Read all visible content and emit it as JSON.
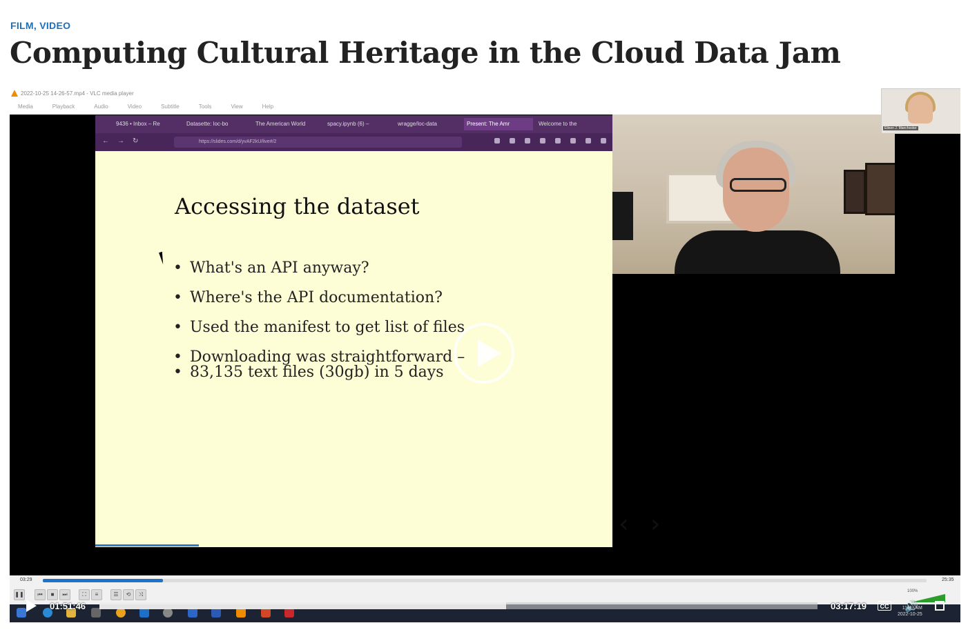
{
  "page": {
    "category": "FILM, VIDEO",
    "title": "Computing Cultural Heritage in the Cloud Data Jam"
  },
  "vlc": {
    "window_title": "2022-10-25 14-26-57.mp4 - VLC media player",
    "menu": [
      "Media",
      "Playback",
      "Audio",
      "Video",
      "Subtitle",
      "Tools",
      "View",
      "Help"
    ],
    "elapsed": "03:29",
    "total": "25:35",
    "progress_fraction": 0.136,
    "volume": "100%"
  },
  "browser": {
    "tabs": [
      {
        "label": "9436 • Inbox – Re",
        "active": false
      },
      {
        "label": "Datasette: loc-bo",
        "active": false
      },
      {
        "label": "The American World",
        "active": false
      },
      {
        "label": "spacy.ipynb (6) –",
        "active": false
      },
      {
        "label": "wragge/loc-data",
        "active": false
      },
      {
        "label": "Present: The Amr",
        "active": true
      },
      {
        "label": "Welcome to the",
        "active": false
      }
    ],
    "url": "https://slides.com/d/yvAF2kU/live#/2"
  },
  "slide": {
    "title": "Accessing the dataset",
    "bullets": [
      "What's an API anyway?",
      "Where's the API documentation?",
      "Used the manifest to get list of files",
      "Downloading was straightforward –",
      "83,135 text files (30gb) in 5 days"
    ],
    "prev_label": "‹",
    "next_label": "›",
    "progress_fraction": 0.2
  },
  "participant": {
    "name": "Eileen J. Manchester"
  },
  "taskbar": {
    "time": "11:06 AM",
    "date": "2022-10-25"
  },
  "web_player": {
    "current_time": "01:51:46",
    "duration": "03:17:19",
    "progress_fraction": 0.566,
    "cc_label": "CC"
  }
}
